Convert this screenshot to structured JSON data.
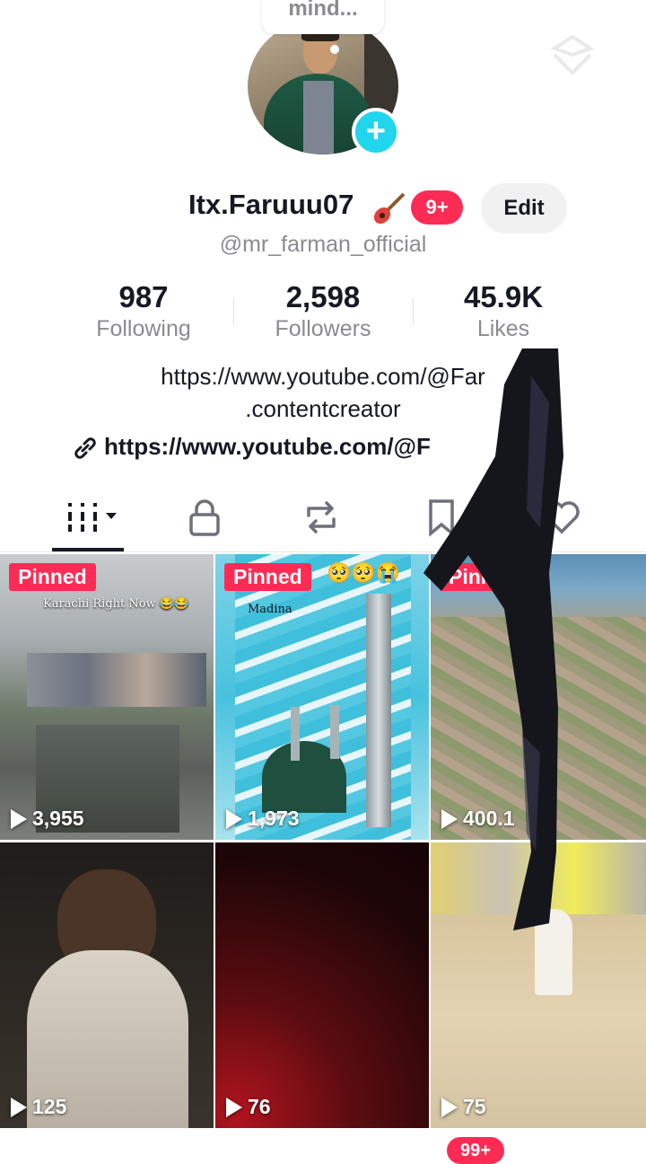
{
  "profile": {
    "bubble_text": "mind...",
    "display_name": "Itx.Faruuu07",
    "notification_badge": "9+",
    "edit_label": "Edit",
    "handle": "@mr_farman_official"
  },
  "stats": [
    {
      "value": "987",
      "label": "Following"
    },
    {
      "value": "2,598",
      "label": "Followers"
    },
    {
      "value": "45.9K",
      "label": "Likes"
    }
  ],
  "bio": {
    "line1": "https://www.youtube.com/@Far",
    "line2": ".contentcreator",
    "link": "https://www.youtube.com/@F"
  },
  "tabs": [
    {
      "icon": "grid-icon",
      "active": true
    },
    {
      "icon": "lock-icon",
      "active": false
    },
    {
      "icon": "repost-icon",
      "active": false
    },
    {
      "icon": "bookmark-icon",
      "active": false
    },
    {
      "icon": "heart-icon",
      "active": false
    }
  ],
  "videos": [
    {
      "pinned_label": "Pinned",
      "views": "3,955",
      "caption": "Karachi Right Now 😂😂"
    },
    {
      "pinned_label": "Pinned",
      "views": "1,973",
      "caption": "Madina",
      "emoji": "🥺🥺😭"
    },
    {
      "pinned_label": "Pinned",
      "views": "400.1"
    },
    {
      "views": "125"
    },
    {
      "views": "76"
    },
    {
      "views": "75"
    }
  ],
  "bottom_badge": "99+",
  "colors": {
    "accent": "#fe2c55",
    "plus": "#20d5ec",
    "text": "#161823",
    "muted": "#8a8b91"
  }
}
